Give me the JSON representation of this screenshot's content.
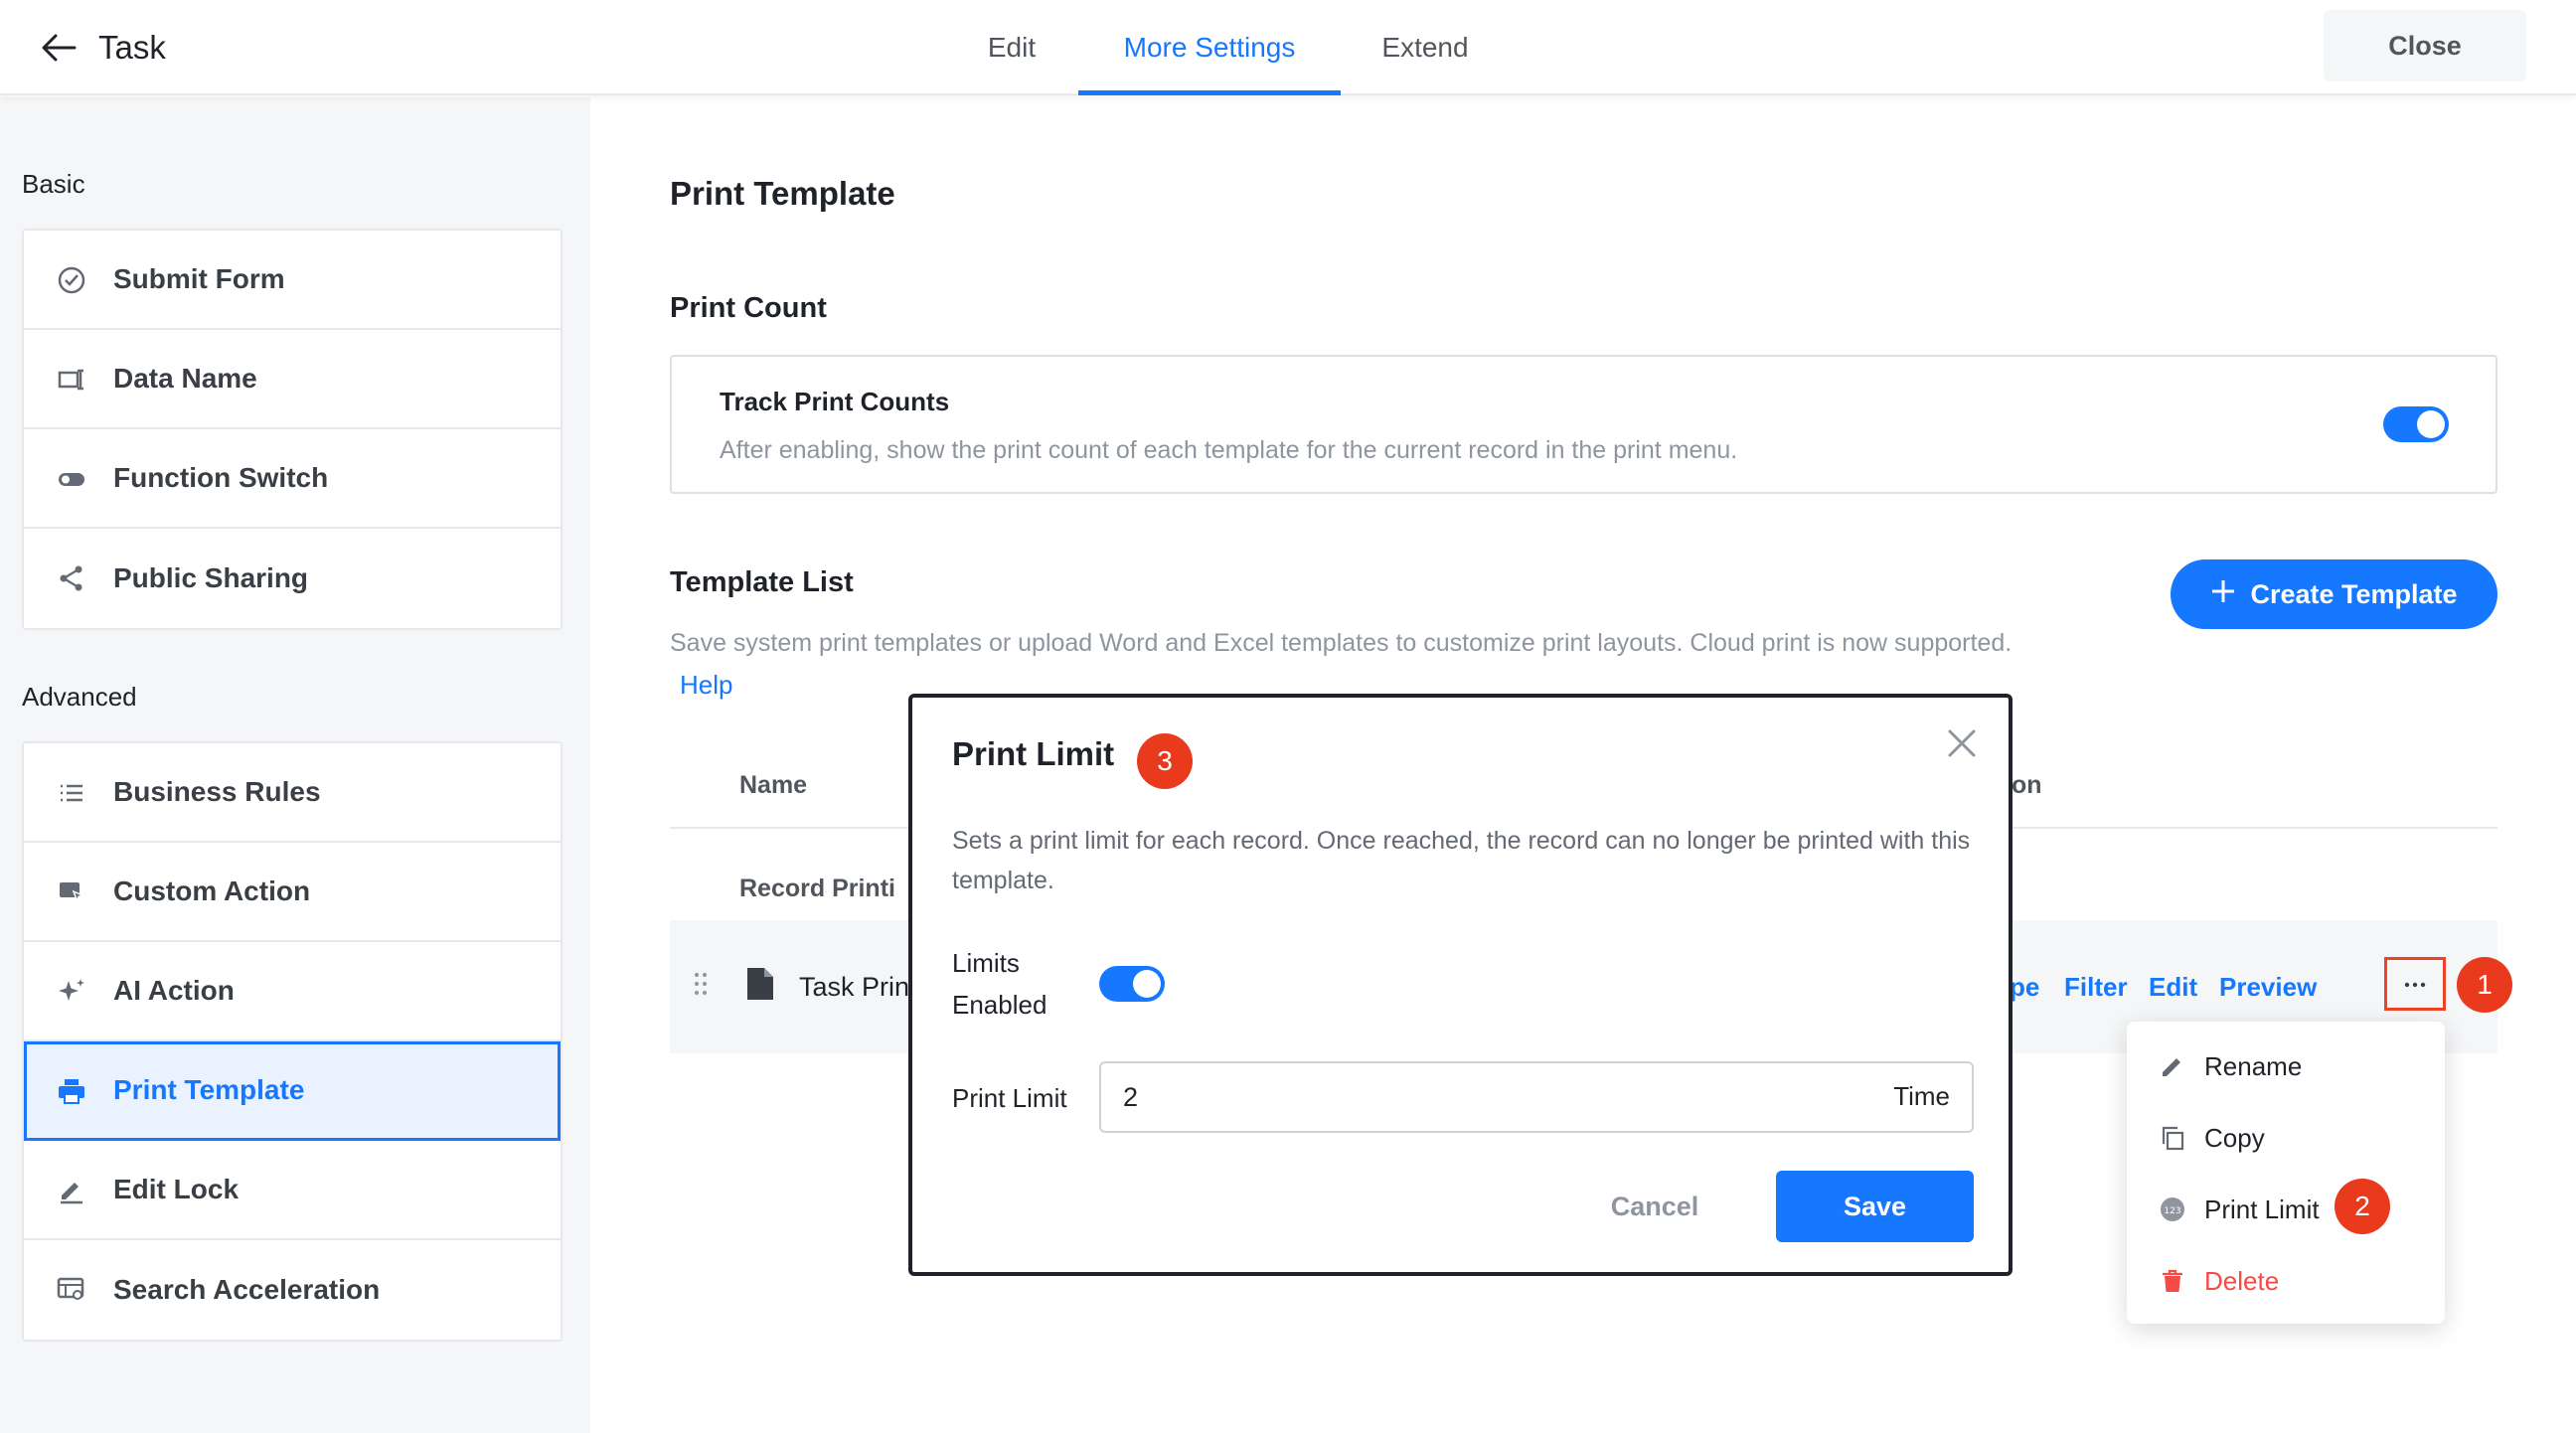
{
  "header": {
    "title": "Task",
    "tabs": [
      {
        "label": "Edit"
      },
      {
        "label": "More Settings"
      },
      {
        "label": "Extend"
      }
    ],
    "close_label": "Close"
  },
  "sidebar": {
    "basic_label": "Basic",
    "basic_items": [
      {
        "label": "Submit Form",
        "icon": "check-circle-icon"
      },
      {
        "label": "Data Name",
        "icon": "text-field-icon"
      },
      {
        "label": "Function Switch",
        "icon": "toggle-icon"
      },
      {
        "label": "Public Sharing",
        "icon": "share-icon"
      }
    ],
    "advanced_label": "Advanced",
    "advanced_items": [
      {
        "label": "Business Rules",
        "icon": "list-icon"
      },
      {
        "label": "Custom Action",
        "icon": "cursor-icon"
      },
      {
        "label": "AI Action",
        "icon": "sparkle-icon"
      },
      {
        "label": "Print Template",
        "icon": "printer-icon",
        "active": true
      },
      {
        "label": "Edit Lock",
        "icon": "pencil-icon"
      },
      {
        "label": "Search Acceleration",
        "icon": "search-accel-icon"
      }
    ]
  },
  "main": {
    "title": "Print Template",
    "print_count": {
      "title": "Print Count",
      "card_title": "Track Print Counts",
      "card_desc": "After enabling, show the print count of each template for the current record in the print menu.",
      "enabled": true
    },
    "template_list": {
      "title": "Template List",
      "create_label": "Create Template",
      "desc": "Save system print templates or upload Word and Excel templates to customize print layouts. Cloud print is now supported.",
      "help_label": "Help",
      "columns": [
        "Name",
        "on"
      ],
      "group_name": "Record Printi",
      "row": {
        "name": "Task Prin",
        "actions": [
          "pe",
          "Filter",
          "Edit",
          "Preview"
        ]
      }
    }
  },
  "dropdown": {
    "items": [
      {
        "label": "Rename",
        "icon": "pencil-icon"
      },
      {
        "label": "Copy",
        "icon": "copy-icon"
      },
      {
        "label": "Print Limit",
        "icon": "counter-icon"
      },
      {
        "label": "Delete",
        "icon": "trash-icon"
      }
    ]
  },
  "badges": [
    "1",
    "2",
    "3"
  ],
  "modal": {
    "title": "Print Limit",
    "desc": "Sets a print limit for each record. Once reached, the record can no longer be printed with this template.",
    "limits_label_1": "Limits",
    "limits_label_2": "Enabled",
    "limits_enabled": true,
    "print_limit_label": "Print Limit",
    "print_limit_value": "2",
    "print_limit_suffix": "Time",
    "cancel_label": "Cancel",
    "save_label": "Save"
  },
  "colors": {
    "accent": "#1677ff",
    "badge": "#ea3a1e",
    "danger": "#f54a45"
  }
}
